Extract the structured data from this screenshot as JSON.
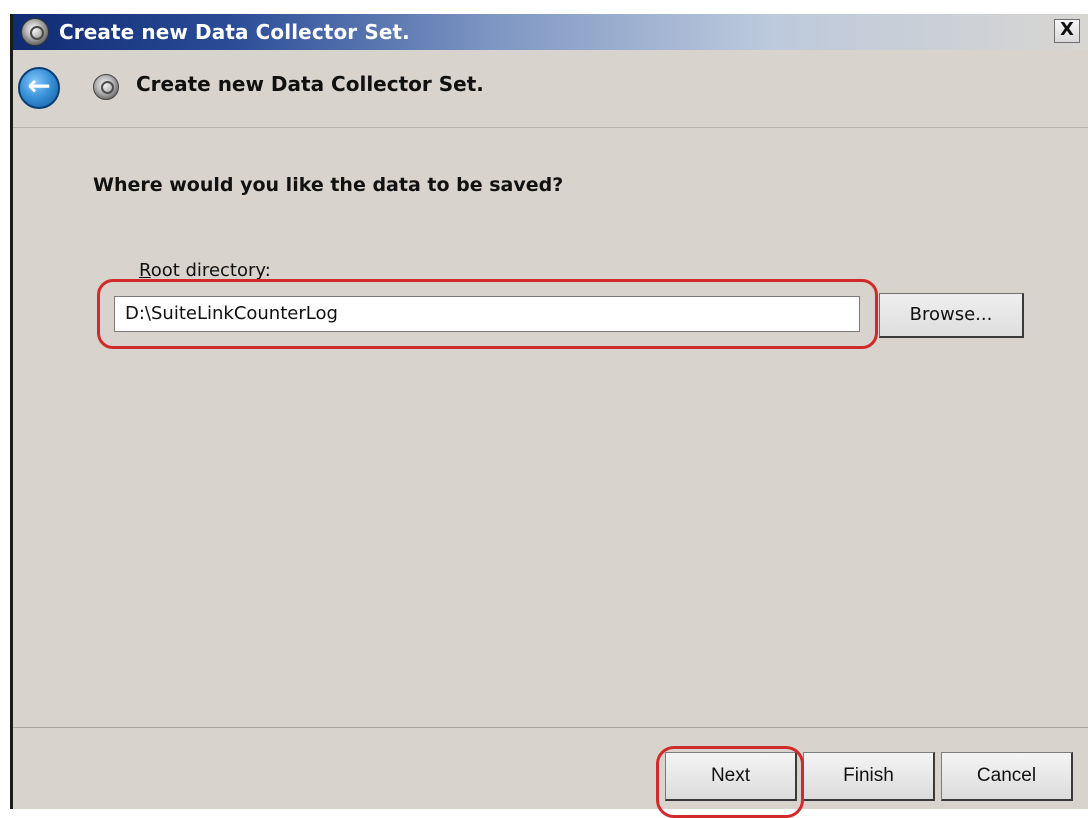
{
  "window": {
    "title": "Create new Data Collector Set.",
    "close_label": "X"
  },
  "header": {
    "title": "Create new Data Collector Set.",
    "back_icon": "back-arrow-icon",
    "wizard_icon": "data-collector-icon"
  },
  "content": {
    "question": "Where would you like the data to be saved?",
    "root_directory_label_hotkey": "R",
    "root_directory_label_rest": "oot directory:",
    "root_directory_value": "D:\\SuiteLinkCounterLog",
    "browse_label": "Browse..."
  },
  "footer": {
    "next_label": "Next",
    "finish_label": "Finish",
    "cancel_label": "Cancel"
  },
  "highlight_color": "#d12a2a"
}
